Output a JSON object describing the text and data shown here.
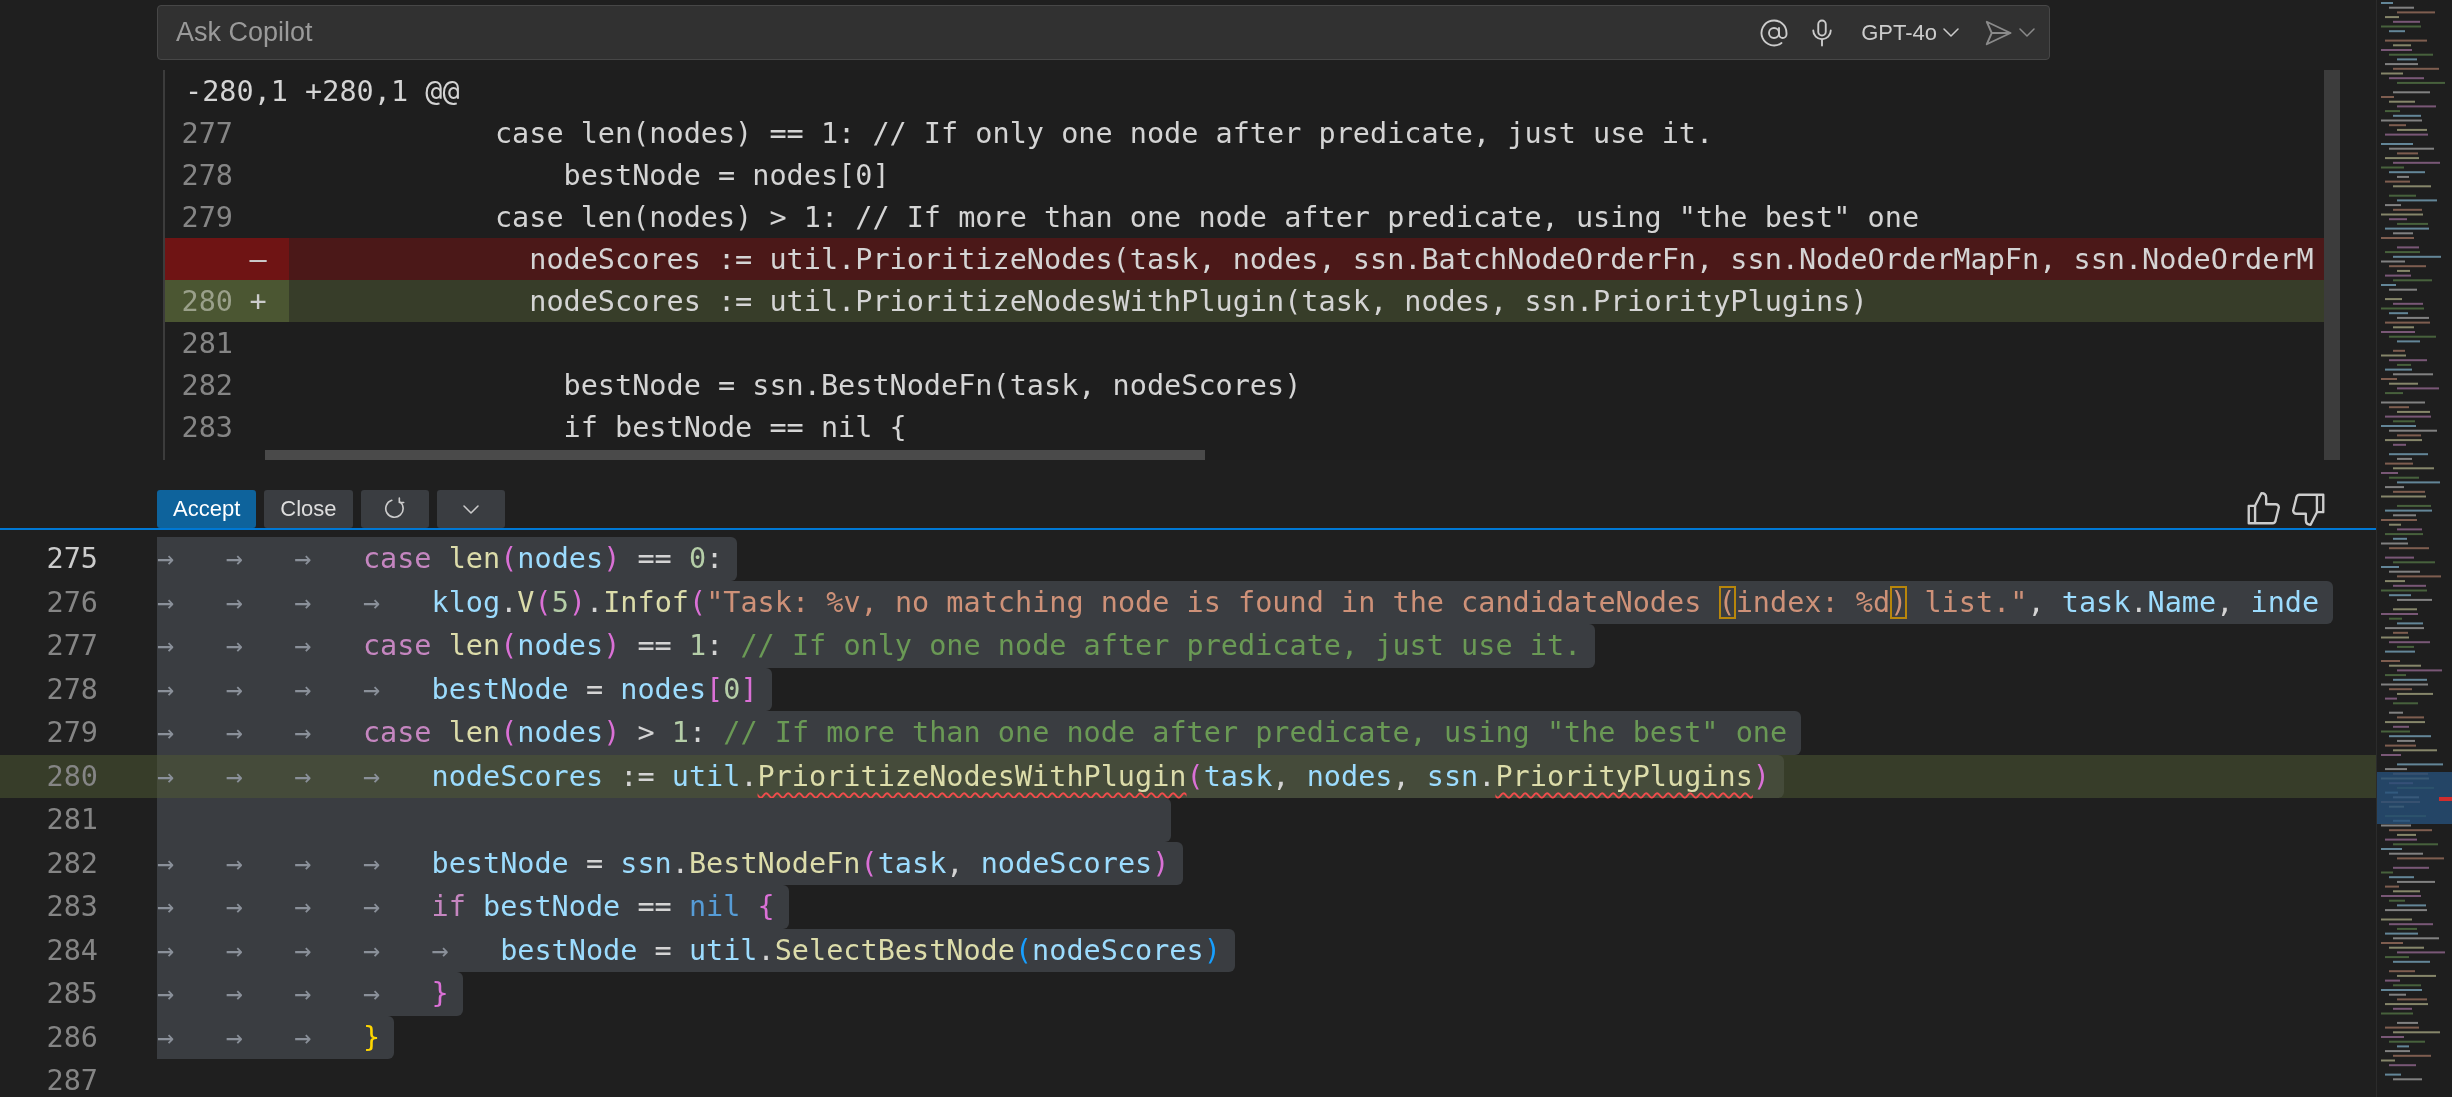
{
  "chat_input": {
    "placeholder": "Ask Copilot",
    "model": "GPT-4o"
  },
  "diff": {
    "header": "-280,1 +280,1 @@",
    "lines": [
      {
        "kind": "context",
        "number": "277",
        "text": "            case len(nodes) == 1: // If only one node after predicate, just use it."
      },
      {
        "kind": "context",
        "number": "278",
        "text": "                bestNode = nodes[0]"
      },
      {
        "kind": "context",
        "number": "279",
        "text": "            case len(nodes) > 1: // If more than one node after predicate, using \"the best\" one"
      },
      {
        "kind": "removed",
        "sign": "–",
        "text": "              nodeScores := util.PrioritizeNodes(task, nodes, ssn.BatchNodeOrderFn, ssn.NodeOrderMapFn, ssn.NodeOrderM"
      },
      {
        "kind": "added",
        "number": "280",
        "sign": "+",
        "text": "              nodeScores := util.PrioritizeNodesWithPlugin(task, nodes, ssn.PriorityPlugins)"
      },
      {
        "kind": "context",
        "number": "281"
      },
      {
        "kind": "context",
        "number": "282",
        "text": "                bestNode = ssn.BestNodeFn(task, nodeScores)"
      },
      {
        "kind": "context",
        "number": "283",
        "text": "                if bestNode == nil {"
      }
    ]
  },
  "actions": {
    "accept": "Accept",
    "close": "Close"
  },
  "editor": {
    "lines": [
      {
        "number": "275",
        "active": true,
        "selected": true,
        "added": false,
        "tokens": [
          {
            "t": "→",
            "kind": "tab"
          },
          {
            "t": "→",
            "kind": "tab"
          },
          {
            "t": "→",
            "kind": "tab"
          },
          {
            "t": "case ",
            "kind": "kw"
          },
          {
            "t": "len",
            "kind": "fn"
          },
          {
            "t": "(",
            "kind": "b2"
          },
          {
            "t": "nodes",
            "kind": "var"
          },
          {
            "t": ")",
            "kind": "b2"
          },
          {
            "t": " == ",
            "kind": "op"
          },
          {
            "t": "0",
            "kind": "num"
          },
          {
            "t": ":",
            "kind": "op"
          }
        ]
      },
      {
        "number": "276",
        "active": false,
        "selected": true,
        "added": false,
        "tokens": [
          {
            "t": "→",
            "kind": "tab"
          },
          {
            "t": "→",
            "kind": "tab"
          },
          {
            "t": "→",
            "kind": "tab"
          },
          {
            "t": "→",
            "kind": "tab"
          },
          {
            "t": "klog",
            "kind": "var"
          },
          {
            "t": ".",
            "kind": "op"
          },
          {
            "t": "V",
            "kind": "fn"
          },
          {
            "t": "(",
            "kind": "b2"
          },
          {
            "t": "5",
            "kind": "num"
          },
          {
            "t": ")",
            "kind": "b2"
          },
          {
            "t": ".",
            "kind": "op"
          },
          {
            "t": "Infof",
            "kind": "fn"
          },
          {
            "t": "(",
            "kind": "b2"
          },
          {
            "t": "\"Task: %v, no matching node is found in the candidateNodes ",
            "kind": "str"
          },
          {
            "t": "(",
            "kind": "str",
            "match": true
          },
          {
            "t": "index: %d",
            "kind": "str"
          },
          {
            "t": ")",
            "kind": "str",
            "match": true
          },
          {
            "t": " list.\"",
            "kind": "str"
          },
          {
            "t": ", ",
            "kind": "op"
          },
          {
            "t": "task",
            "kind": "var"
          },
          {
            "t": ".",
            "kind": "op"
          },
          {
            "t": "Name",
            "kind": "var"
          },
          {
            "t": ", ",
            "kind": "op"
          },
          {
            "t": "inde",
            "kind": "var"
          }
        ]
      },
      {
        "number": "277",
        "active": false,
        "selected": true,
        "added": false,
        "tokens": [
          {
            "t": "→",
            "kind": "tab"
          },
          {
            "t": "→",
            "kind": "tab"
          },
          {
            "t": "→",
            "kind": "tab"
          },
          {
            "t": "case ",
            "kind": "kw"
          },
          {
            "t": "len",
            "kind": "fn"
          },
          {
            "t": "(",
            "kind": "b2"
          },
          {
            "t": "nodes",
            "kind": "var"
          },
          {
            "t": ")",
            "kind": "b2"
          },
          {
            "t": " == ",
            "kind": "op"
          },
          {
            "t": "1",
            "kind": "num"
          },
          {
            "t": ": ",
            "kind": "op"
          },
          {
            "t": "// If only one node after predicate, just use it.",
            "kind": "com"
          }
        ]
      },
      {
        "number": "278",
        "active": false,
        "selected": true,
        "added": false,
        "tokens": [
          {
            "t": "→",
            "kind": "tab"
          },
          {
            "t": "→",
            "kind": "tab"
          },
          {
            "t": "→",
            "kind": "tab"
          },
          {
            "t": "→",
            "kind": "tab"
          },
          {
            "t": "bestNode",
            "kind": "var"
          },
          {
            "t": " = ",
            "kind": "op"
          },
          {
            "t": "nodes",
            "kind": "var"
          },
          {
            "t": "[",
            "kind": "b2"
          },
          {
            "t": "0",
            "kind": "num"
          },
          {
            "t": "]",
            "kind": "b2"
          }
        ]
      },
      {
        "number": "279",
        "active": false,
        "selected": true,
        "added": false,
        "tokens": [
          {
            "t": "→",
            "kind": "tab"
          },
          {
            "t": "→",
            "kind": "tab"
          },
          {
            "t": "→",
            "kind": "tab"
          },
          {
            "t": "case ",
            "kind": "kw"
          },
          {
            "t": "len",
            "kind": "fn"
          },
          {
            "t": "(",
            "kind": "b2"
          },
          {
            "t": "nodes",
            "kind": "var"
          },
          {
            "t": ")",
            "kind": "b2"
          },
          {
            "t": " > ",
            "kind": "op"
          },
          {
            "t": "1",
            "kind": "num"
          },
          {
            "t": ": ",
            "kind": "op"
          },
          {
            "t": "// If more than one node after predicate, using \"the best\" one",
            "kind": "com"
          }
        ]
      },
      {
        "number": "280",
        "active": false,
        "selected": true,
        "added": true,
        "tokens": [
          {
            "t": "→",
            "kind": "tab"
          },
          {
            "t": "→",
            "kind": "tab"
          },
          {
            "t": "→",
            "kind": "tab"
          },
          {
            "t": "→",
            "kind": "tab"
          },
          {
            "t": "nodeScores",
            "kind": "var"
          },
          {
            "t": " := ",
            "kind": "op"
          },
          {
            "t": "util",
            "kind": "var"
          },
          {
            "t": ".",
            "kind": "op"
          },
          {
            "t": "PrioritizeNodesWithPlugin",
            "kind": "fn",
            "squiggle": true
          },
          {
            "t": "(",
            "kind": "b2"
          },
          {
            "t": "task",
            "kind": "var"
          },
          {
            "t": ", ",
            "kind": "op"
          },
          {
            "t": "nodes",
            "kind": "var"
          },
          {
            "t": ", ",
            "kind": "op"
          },
          {
            "t": "ssn",
            "kind": "var"
          },
          {
            "t": ".",
            "kind": "op"
          },
          {
            "t": "PriorityPlugins",
            "kind": "fn",
            "squiggle": true
          },
          {
            "t": ")",
            "kind": "b2"
          }
        ]
      },
      {
        "number": "281",
        "active": false,
        "selected": true,
        "added": false
      },
      {
        "number": "282",
        "active": false,
        "selected": true,
        "added": false,
        "tokens": [
          {
            "t": "→",
            "kind": "tab"
          },
          {
            "t": "→",
            "kind": "tab"
          },
          {
            "t": "→",
            "kind": "tab"
          },
          {
            "t": "→",
            "kind": "tab"
          },
          {
            "t": "bestNode",
            "kind": "var"
          },
          {
            "t": " = ",
            "kind": "op"
          },
          {
            "t": "ssn",
            "kind": "var"
          },
          {
            "t": ".",
            "kind": "op"
          },
          {
            "t": "BestNodeFn",
            "kind": "fn"
          },
          {
            "t": "(",
            "kind": "b2"
          },
          {
            "t": "task",
            "kind": "var"
          },
          {
            "t": ", ",
            "kind": "op"
          },
          {
            "t": "nodeScores",
            "kind": "var"
          },
          {
            "t": ")",
            "kind": "b2"
          }
        ]
      },
      {
        "number": "283",
        "active": false,
        "selected": true,
        "added": false,
        "tokens": [
          {
            "t": "→",
            "kind": "tab"
          },
          {
            "t": "→",
            "kind": "tab"
          },
          {
            "t": "→",
            "kind": "tab"
          },
          {
            "t": "→",
            "kind": "tab"
          },
          {
            "t": "if ",
            "kind": "kw"
          },
          {
            "t": "bestNode",
            "kind": "var"
          },
          {
            "t": " == ",
            "kind": "op"
          },
          {
            "t": "nil ",
            "kind": "const"
          },
          {
            "t": "{",
            "kind": "b2"
          }
        ]
      },
      {
        "number": "284",
        "active": false,
        "selected": true,
        "added": false,
        "tokens": [
          {
            "t": "→",
            "kind": "tab"
          },
          {
            "t": "→",
            "kind": "tab"
          },
          {
            "t": "→",
            "kind": "tab"
          },
          {
            "t": "→",
            "kind": "tab"
          },
          {
            "t": "→",
            "kind": "tab"
          },
          {
            "t": "bestNode",
            "kind": "var"
          },
          {
            "t": " = ",
            "kind": "op"
          },
          {
            "t": "util",
            "kind": "var"
          },
          {
            "t": ".",
            "kind": "op"
          },
          {
            "t": "SelectBestNode",
            "kind": "fn"
          },
          {
            "t": "(",
            "kind": "b3"
          },
          {
            "t": "nodeScores",
            "kind": "var"
          },
          {
            "t": ")",
            "kind": "b3"
          }
        ]
      },
      {
        "number": "285",
        "active": false,
        "selected": true,
        "added": false,
        "tokens": [
          {
            "t": "→",
            "kind": "tab"
          },
          {
            "t": "→",
            "kind": "tab"
          },
          {
            "t": "→",
            "kind": "tab"
          },
          {
            "t": "→",
            "kind": "tab"
          },
          {
            "t": "}",
            "kind": "b2"
          }
        ]
      },
      {
        "number": "286",
        "active": false,
        "selected": true,
        "added": false,
        "tokens": [
          {
            "t": "→",
            "kind": "tab"
          },
          {
            "t": "→",
            "kind": "tab"
          },
          {
            "t": "→",
            "kind": "tab"
          },
          {
            "t": "}",
            "kind": "b1"
          }
        ]
      },
      {
        "number": "287",
        "active": false,
        "selected": false,
        "added": false
      }
    ]
  }
}
